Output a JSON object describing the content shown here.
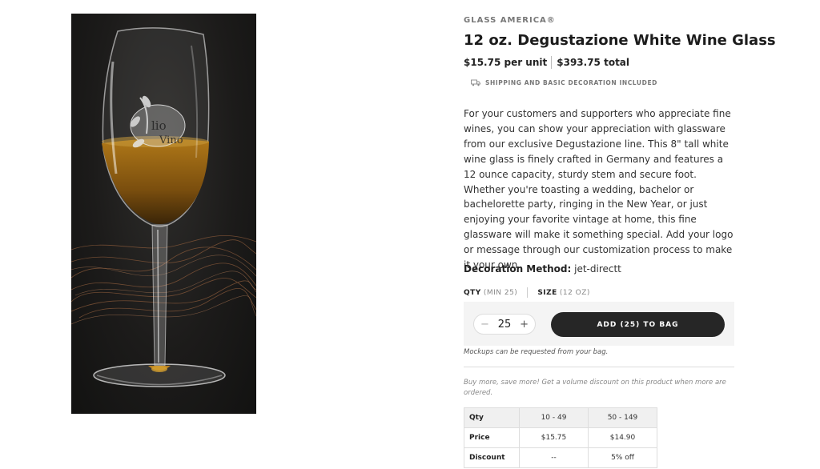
{
  "product_image": {
    "alt": "12 oz. Degustazione White Wine Glass with Olio & Vino logo",
    "logo_text": "Olio & Vino"
  },
  "product": {
    "brand": "GLASS AMERICA®",
    "title": "12 oz. Degustazione White Wine Glass",
    "unit_price": "$15.75 per unit",
    "total_price": "$393.75 total",
    "shipping_note": "SHIPPING AND BASIC DECORATION INCLUDED",
    "description": "For your customers and supporters who appreciate fine wines, you can show your appreciation with glassware from our exclusive Degustazione line. This 8\" tall white wine glass is finely crafted in Germany and features a 12 ounce capacity, sturdy stem and secure foot. Whether you're toasting a wedding, bachelor or bachelorette party, ringing in the New Year, or just enjoying your favorite vintage at home, this fine glassware will make it something special. Add your logo or message through our customization process to make it your own.",
    "decoration_label": "Decoration Method:",
    "decoration_value": "jet-directt"
  },
  "options": {
    "qty_label": "QTY",
    "qty_min": "(MIN 25)",
    "size_label": "SIZE",
    "size_value": "(12 OZ)"
  },
  "buy": {
    "minus": "−",
    "quantity": "25",
    "plus": "+",
    "add_button": "ADD (25) TO BAG",
    "mockup_note": "Mockups can be requested from your bag."
  },
  "volume": {
    "note": "Buy more, save more! Get a volume discount on this product when more are ordered.",
    "header": [
      "Qty",
      "10 - 49",
      "50 - 149"
    ],
    "price": [
      "Price",
      "$15.75",
      "$14.90"
    ],
    "discount": [
      "Discount",
      "--",
      "5% off"
    ]
  },
  "icons": {
    "shipping": "truck-icon",
    "minus": "minus-icon",
    "plus": "plus-icon"
  }
}
